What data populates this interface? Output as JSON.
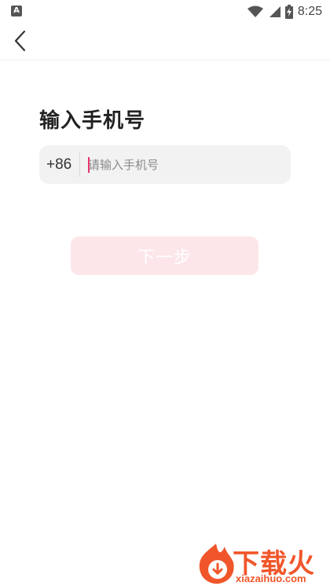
{
  "status_bar": {
    "time": "8:25",
    "icons": [
      "notification-a-icon",
      "wifi-icon",
      "signal-icon",
      "battery-icon"
    ]
  },
  "nav": {
    "back_icon": "chevron-left-icon"
  },
  "main": {
    "title": "输入手机号",
    "country_code": "+86",
    "phone_placeholder": "请输入手机号",
    "next_label": "下一步"
  },
  "watermark": {
    "logo_text": "下载火",
    "url": "xiazaihuo.com"
  },
  "colors": {
    "accent": "#e8316a",
    "button_disabled_bg": "#fde6ea",
    "input_bg": "#f2f2f2",
    "watermark": "#f0562a"
  }
}
